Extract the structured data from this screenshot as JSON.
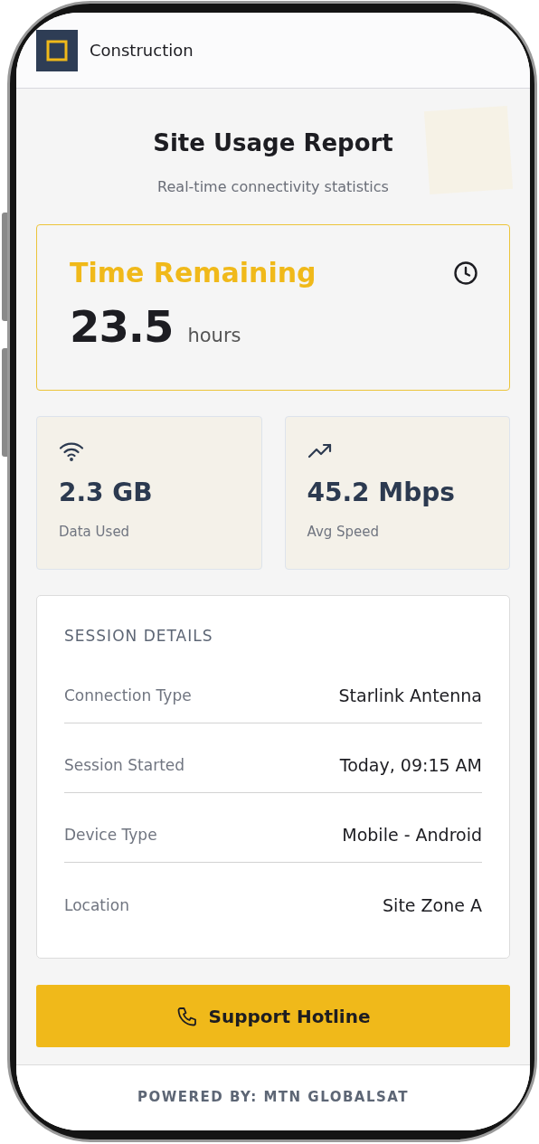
{
  "header": {
    "brand": "Construction"
  },
  "title": "Site Usage Report",
  "subtitle": "Real-time connectivity statistics",
  "time_remaining": {
    "label": "Time Remaining",
    "value": "23.5",
    "unit": "hours"
  },
  "stats": [
    {
      "kind": "wifi",
      "value": "2.3 GB",
      "label": "Data Used"
    },
    {
      "kind": "trend",
      "value": "45.2 Mbps",
      "label": "Avg Speed"
    }
  ],
  "session": {
    "heading": "SESSION DETAILS",
    "rows": [
      {
        "label": "Connection Type",
        "value": "Starlink Antenna"
      },
      {
        "label": "Session Started",
        "value": "Today, 09:15 AM"
      },
      {
        "label": "Device Type",
        "value": "Mobile - Android"
      },
      {
        "label": "Location",
        "value": "Site Zone A"
      }
    ]
  },
  "support_button": "Support Hotline",
  "footer": "POWERED BY: MTN GLOBALSAT"
}
